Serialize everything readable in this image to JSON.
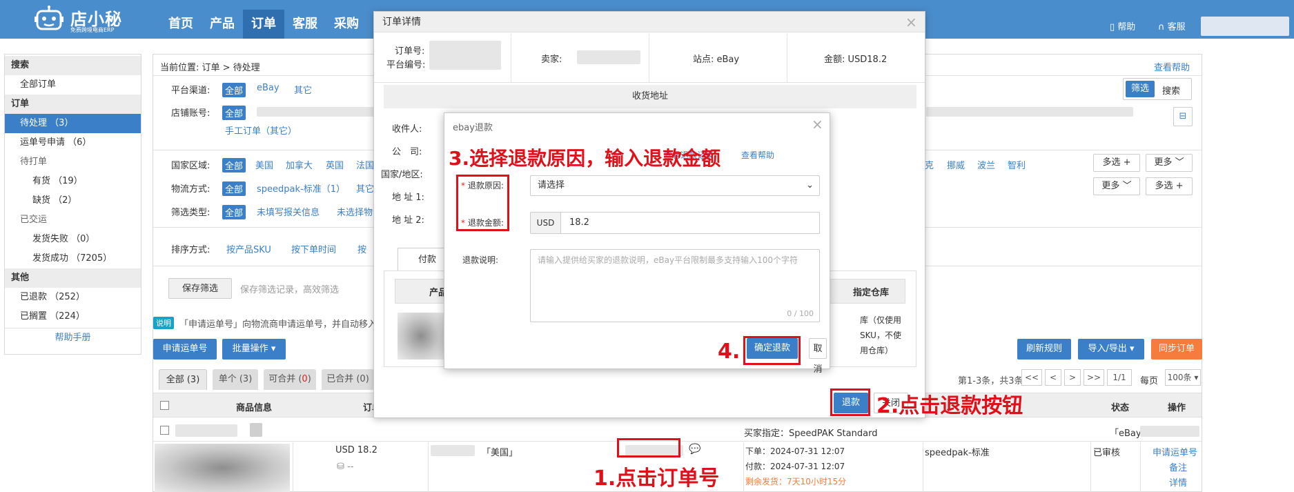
{
  "app": {
    "logo_name": "店小秘",
    "logo_sub": "免费跨境电商ERP",
    "nav": [
      "首页",
      "产品",
      "订单",
      "客服",
      "采购"
    ],
    "help": "帮助",
    "service": "客服"
  },
  "sidebar": {
    "search_head": "搜索",
    "all_orders": "全部订单",
    "order_head": "订单",
    "pending": "待处理 （3）",
    "waybill_apply": "运单号申请 （6）",
    "to_print": "待打单",
    "in_stock": "有货 （19）",
    "out_stock": "缺货 （2）",
    "shipped": "已交运",
    "ship_fail": "发货失败 （0）",
    "ship_ok": "发货成功 （7205）",
    "other_head": "其他",
    "refunded": "已退款 （252）",
    "on_hold": "已搁置 （224）",
    "manual": "帮助手册"
  },
  "main": {
    "breadcrumb": "当前位置:  订单 > 待处理",
    "view_help": "查看帮助",
    "filter_btn": "筛选",
    "search_btn": "搜索",
    "channel_label": "平台渠道:",
    "channel_opts": [
      "全部",
      "eBay",
      "其它"
    ],
    "store_label": "店铺账号:",
    "store_all": "全部",
    "manual_order": "手工订单（其它）",
    "region_label": "国家区域:",
    "region_opts": [
      "全部",
      "美国",
      "加拿大",
      "英国",
      "法国"
    ],
    "region_more": [
      "克",
      "挪威",
      "波兰",
      "智利"
    ],
    "multi_select": "多选 +",
    "more": "更多",
    "ship_label": "物流方式:",
    "ship_opts": [
      "全部",
      "speedpak-标准（1）",
      "其它"
    ],
    "filter_type_label": "筛选类型:",
    "filter_type_opts": [
      "全部",
      "未填写报关信息",
      "未选择物流"
    ],
    "sort_label": "排序方式:",
    "sort_opts": [
      "按产品SKU",
      "按下单时间",
      "按"
    ],
    "save_filter": "保存筛选",
    "save_filter_tip": "保存筛选记录，高效筛选",
    "notice_badge": "说明",
    "notice_text": "「申请运单号」向物流商申请运单号，并自动移入",
    "apply_waybill": "申请运单号",
    "batch_ops": "批量操作",
    "refresh_rule": "刷新规则",
    "import_export": "导入/导出",
    "sync_orders": "同步订单",
    "tabs": {
      "all": "全部 (3)",
      "single": "单个 (3)",
      "mergeable_pre": "可合并 (",
      "mergeable_num": "0",
      "mergeable_post": ")",
      "merged": "已合并 (0)"
    },
    "pager": {
      "summary": "第1-3条，共3条",
      "first": "<<",
      "prev": "<",
      "next": ">",
      "last": ">>",
      "page": "1/1",
      "per_page_label": "每页",
      "per_page": "100条"
    },
    "columns": {
      "product": "商品信息",
      "order": "订单",
      "status": "状态",
      "ops": "操作"
    },
    "row": {
      "buyer_pref": "买家指定：SpeedPAK Standard",
      "ebay_prefix": "「eBay:",
      "amount": "USD 18.2",
      "dash": "--",
      "country": "「美国」",
      "order_time": "下单：2024-07-31 12:07",
      "pay_time": "付款：2024-07-31 12:07",
      "remaining": "剩余发货：7天10小时15分",
      "shipping": "speedpak-标准",
      "status": "已审核",
      "op_apply": "申请运单号",
      "op_note": "备注",
      "op_detail": "详情"
    }
  },
  "detail_modal": {
    "title": "订单详情",
    "order_no_label": "订单号:",
    "platform_no_label": "平台编号:",
    "seller_label": "卖家:",
    "site_label": "站点: eBay",
    "amount_label": "金额: USD18.2",
    "address_title": "收货地址",
    "recipient": "收件人:",
    "company": "公　司:",
    "country": "国家/地区:",
    "addr1": "地 址 1:",
    "addr2": "地 址 2:",
    "tab_pay": "付款",
    "col_product": "产品",
    "col_warehouse": "指定仓库",
    "wh_note1": "库（仅使用",
    "wh_note2": "SKU，不使",
    "wh_note3": "用仓库）",
    "refund_btn": "退款",
    "close_btn": "关闭"
  },
  "refund_modal": {
    "title": "ebay退款",
    "view_records": "查看退款记录",
    "view_help": "查看帮助",
    "reason_label": "退款原因:",
    "reason_placeholder": "请选择",
    "amount_label": "退款金额:",
    "currency": "USD",
    "amount_value": "18.2",
    "desc_label": "退款说明:",
    "desc_placeholder": "请输入提供给买家的退款说明，eBay平台限制最多支持输入100个字符",
    "counter": "0 / 100",
    "confirm": "确定退款",
    "cancel": "取消"
  },
  "annotations": {
    "step1": "1.点击订单号",
    "step2": "2.点击退款按钮",
    "step3": "3.选择退款原因，输入退款金额",
    "step4": "4."
  },
  "colors": {
    "topbar": "#4a8dcc",
    "primary": "#3a7fc8",
    "orange": "#f57c3c",
    "annotation": "#e0101a"
  }
}
